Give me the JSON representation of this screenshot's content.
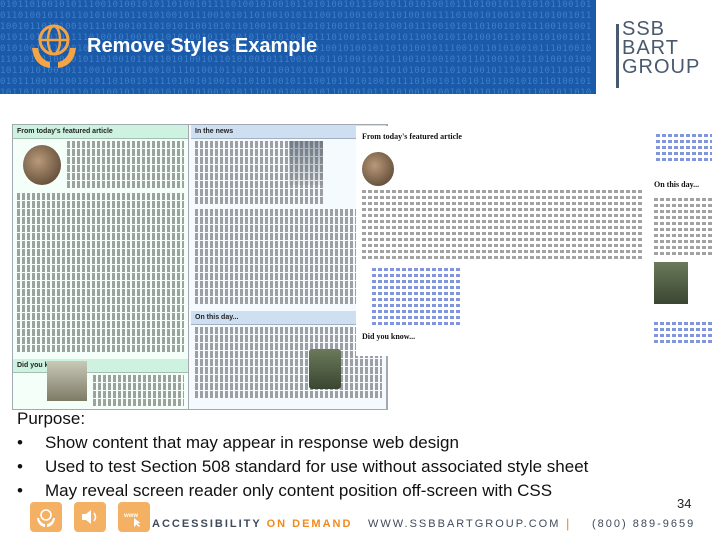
{
  "slide": {
    "title": "Remove Styles Example",
    "page_number": "34"
  },
  "logo": {
    "lines": [
      "SSB",
      "BART",
      "GROUP"
    ]
  },
  "content": {
    "purpose_label": "Purpose:",
    "bullets": [
      "Show content that may appear in response web design",
      "Used to test Section 508 standard for use without associated style sheet",
      "May reveal screen reader only content position off-screen with CSS"
    ]
  },
  "screenshot_left": {
    "sections": {
      "featured": "From today's featured article",
      "news": "In the news",
      "did_you_know": "Did you know...",
      "on_this_day": "On this day..."
    }
  },
  "screenshot_right": {
    "featured": "From today's featured article",
    "on_this_day": "On this day...",
    "did_you_know": "Did you know..."
  },
  "footer": {
    "accessibility": "ACCESSIBILITY",
    "on_demand": "ON DEMAND",
    "website": "WWW.SSBBARTGROUP.COM",
    "separator": "|",
    "phone": "(800) 889-9659"
  },
  "colors": {
    "banner": "#1a5aa8",
    "accent": "#f08a1c",
    "logo_text": "#4a5a6e"
  }
}
